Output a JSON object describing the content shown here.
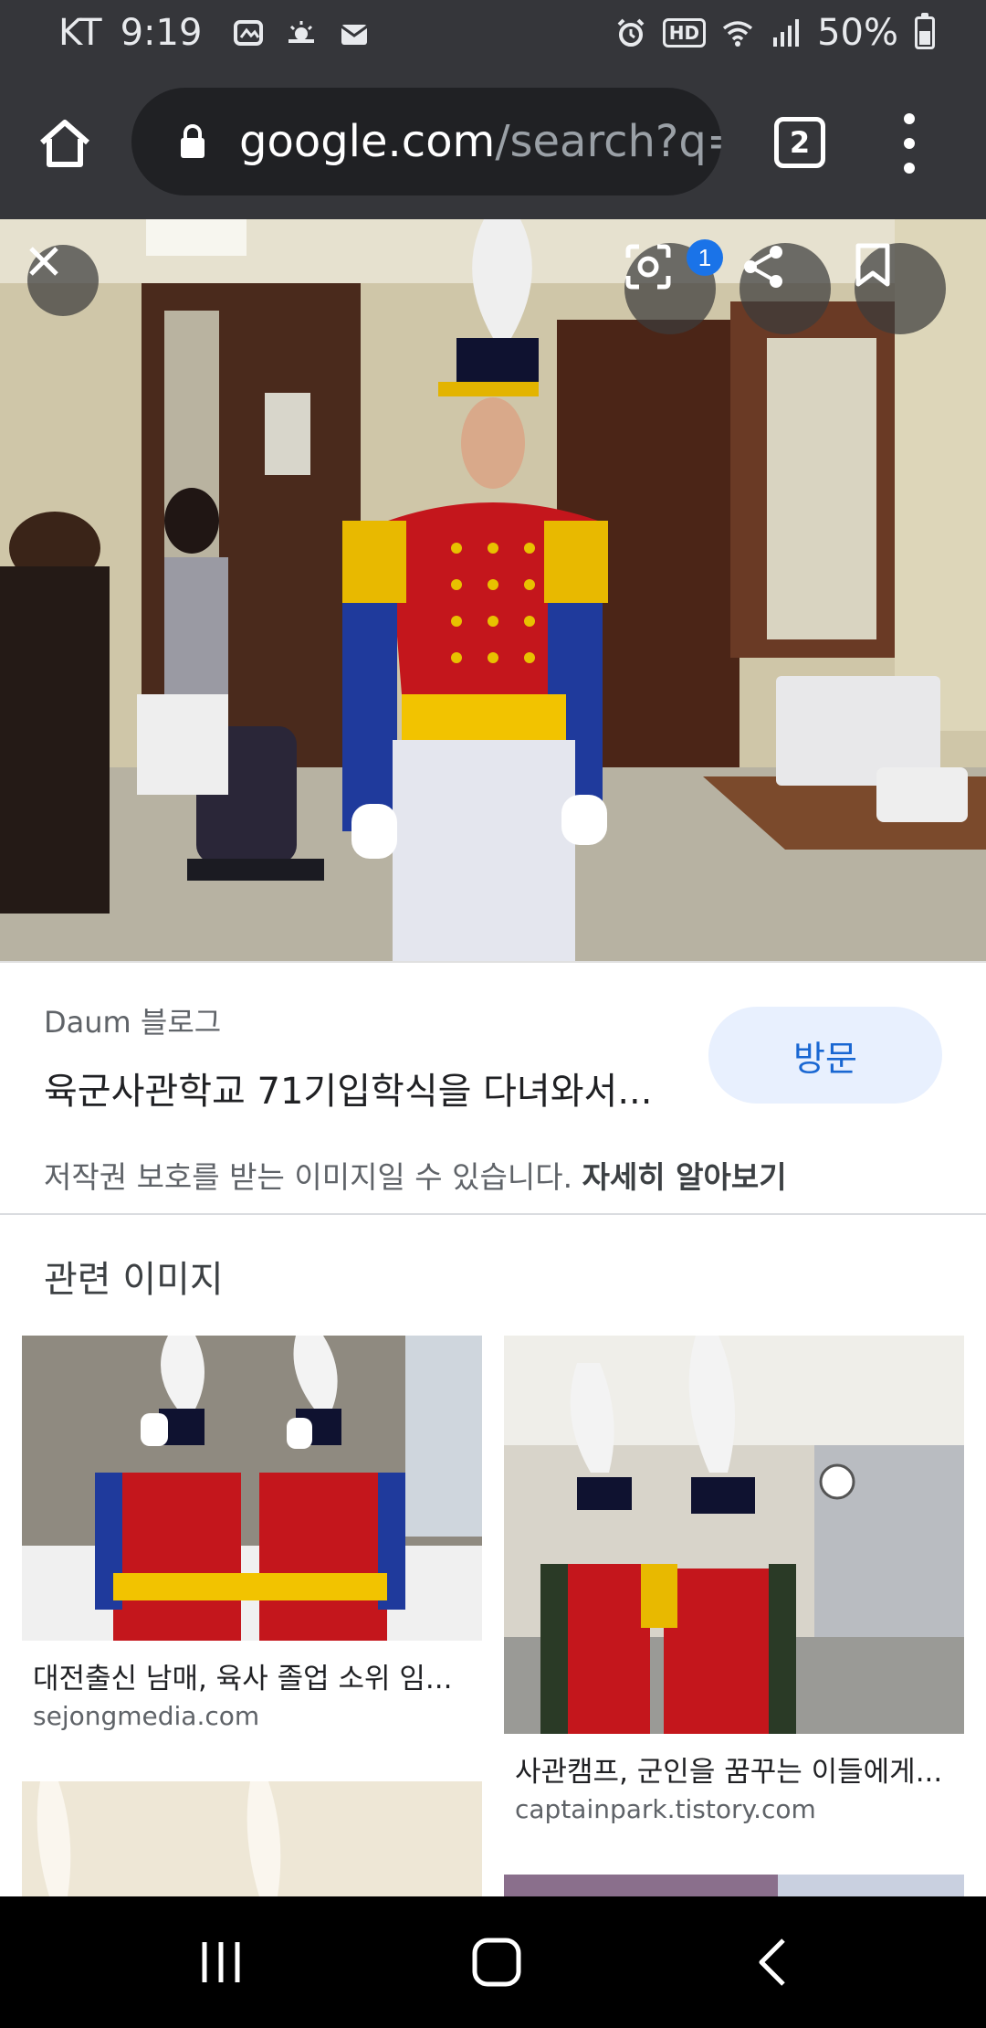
{
  "status_bar": {
    "carrier": "KT",
    "time": "9:19",
    "battery": "50%",
    "battery_level": 0.5,
    "icons": [
      "gallery-icon",
      "weather-icon",
      "mail-icon",
      "alarm-icon",
      "hd-icon",
      "wifi-icon",
      "signal-icon",
      "battery-icon"
    ],
    "hd_label": "HD"
  },
  "browser": {
    "url_host": "google.com",
    "url_path": "/search?q=",
    "tab_count": "2",
    "icons": [
      "home-icon",
      "lock-icon",
      "tabs-icon",
      "more-vert-icon"
    ]
  },
  "viewer": {
    "lens_badge": "1",
    "icons": [
      "close-icon",
      "lens-icon",
      "share-icon",
      "bookmark-icon"
    ]
  },
  "result": {
    "source": "Daum 블로그",
    "title": "육군사관학교 71기입학식을 다녀와서...",
    "visit_label": "방문",
    "copyright_text": "저작권 보호를 받는 이미지일 수 있습니다.",
    "learn_more": "자세히 알아보기"
  },
  "related": {
    "heading": "관련 이미지",
    "items": [
      {
        "caption": "대전출신 남매, 육사 졸업 소위 임...",
        "domain": "sejongmedia.com"
      },
      {
        "caption": "사관캠프, 군인을 꿈꾸는 이들에게...",
        "domain": "captainpark.tistory.com"
      }
    ]
  },
  "nav": {
    "icons": [
      "recents-icon",
      "home-nav-icon",
      "back-icon"
    ]
  },
  "colors": {
    "toolbar": "#35363a",
    "url_bar": "#202124",
    "visit_bg": "#e8f0fe",
    "visit_text": "#1967d2",
    "badge": "#1a73e8"
  }
}
